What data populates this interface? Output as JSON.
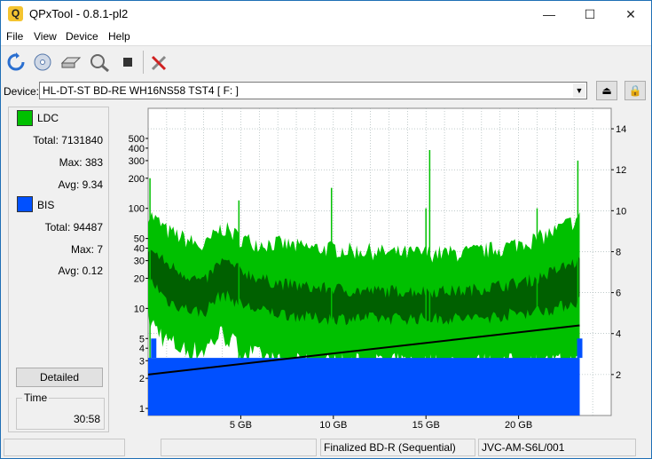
{
  "window": {
    "title": "QPxTool - 0.8.1-pl2",
    "app_icon": "Q",
    "minimize": "—",
    "maximize": "☐",
    "close": "✕"
  },
  "menu": [
    "File",
    "View",
    "Device",
    "Help"
  ],
  "toolbar": {
    "icons": [
      "refresh-icon",
      "disc-scan-icon",
      "drive-icon",
      "magnify-disc-icon",
      "stop-icon",
      "tools-icon"
    ]
  },
  "device": {
    "label": "Device:",
    "value": "HL-DT-ST BD-RE  WH16NS58  TST4 [ F: ]",
    "eject_icon": "⏏",
    "lock_icon": "🔒"
  },
  "stats": {
    "ldc": {
      "name": "LDC",
      "color": "#00c000",
      "total_label": "Total:",
      "total": "7131840",
      "max_label": "Max:",
      "max": "383",
      "avg_label": "Avg:",
      "avg": "9.34"
    },
    "bis": {
      "name": "BIS",
      "color": "#0050ff",
      "total_label": "Total:",
      "total": "94487",
      "max_label": "Max:",
      "max": "7",
      "avg_label": "Avg:",
      "avg": "0.12"
    }
  },
  "detailed_button": "Detailed",
  "time": {
    "label": "Time",
    "value": "30:58"
  },
  "status": {
    "cell3": "Finalized BD-R (Sequential)",
    "cell4": "JVC-AM-S6L/001"
  },
  "chart_data": {
    "type": "area",
    "x_unit": "GB",
    "xlim": [
      0,
      25
    ],
    "x_ticks": [
      5,
      10,
      15,
      20
    ],
    "x_tick_labels": [
      "5 GB",
      "10 GB",
      "15 GB",
      "20 GB"
    ],
    "y_left_scale": "log",
    "y_left_ticks": [
      1,
      2,
      3,
      4,
      5,
      10,
      20,
      30,
      40,
      50,
      100,
      200,
      300,
      400,
      500
    ],
    "y_left_range": [
      0.85,
      1000
    ],
    "y_right_ticks": [
      2,
      4,
      6,
      8,
      10,
      12,
      14
    ],
    "y_right_range": [
      0,
      15
    ],
    "data_end_gb": 23.3,
    "series": [
      {
        "name": "LDC",
        "color": "#00c000",
        "x": [
          0,
          1,
          2,
          3,
          4,
          5,
          6,
          7,
          8,
          9,
          10,
          11,
          12,
          13,
          14,
          15,
          16,
          17,
          18,
          19,
          20,
          21,
          22,
          23.3
        ],
        "max": [
          90,
          60,
          50,
          40,
          65,
          50,
          45,
          45,
          42,
          40,
          40,
          38,
          38,
          36,
          36,
          36,
          36,
          36,
          38,
          40,
          45,
          50,
          60,
          80
        ],
        "min": [
          8,
          5,
          4,
          4,
          6,
          4,
          3.5,
          3,
          3,
          3,
          3,
          3,
          3,
          3,
          3,
          3,
          3,
          3,
          3,
          3,
          3,
          3,
          3,
          3
        ],
        "spikes": [
          {
            "x": 0.1,
            "y": 200
          },
          {
            "x": 4.9,
            "y": 120
          },
          {
            "x": 9.9,
            "y": 160
          },
          {
            "x": 15.2,
            "y": 383
          },
          {
            "x": 15.0,
            "y": 100
          },
          {
            "x": 21.0,
            "y": 100
          },
          {
            "x": 23.2,
            "y": 300
          }
        ]
      },
      {
        "name": "LDC avg",
        "color": "#006000",
        "x": [
          0,
          1,
          2,
          3,
          4,
          5,
          6,
          7,
          8,
          9,
          10,
          11,
          12,
          13,
          14,
          15,
          16,
          17,
          18,
          19,
          20,
          21,
          22,
          23.3
        ],
        "high": [
          40,
          28,
          22,
          18,
          30,
          24,
          20,
          18,
          17,
          16,
          16,
          15,
          15,
          15,
          15,
          15,
          15,
          15,
          16,
          17,
          18,
          20,
          24,
          30
        ],
        "low": [
          20,
          12,
          10,
          9,
          14,
          11,
          9.5,
          9,
          8.5,
          8,
          8,
          8,
          8,
          8,
          8,
          8,
          8,
          8,
          8,
          8.5,
          9,
          9.5,
          10,
          12
        ]
      },
      {
        "name": "BIS",
        "color": "#0050ff",
        "x": [
          0,
          23.3
        ],
        "level": [
          3.2,
          3.2
        ],
        "peaks": [
          {
            "x": 0.3,
            "y": 5
          },
          {
            "x": 23.3,
            "y": 5
          }
        ]
      },
      {
        "name": "Speed",
        "color": "#000000",
        "x": [
          0,
          23.3
        ],
        "y_right": [
          2.0,
          4.4
        ]
      }
    ]
  }
}
